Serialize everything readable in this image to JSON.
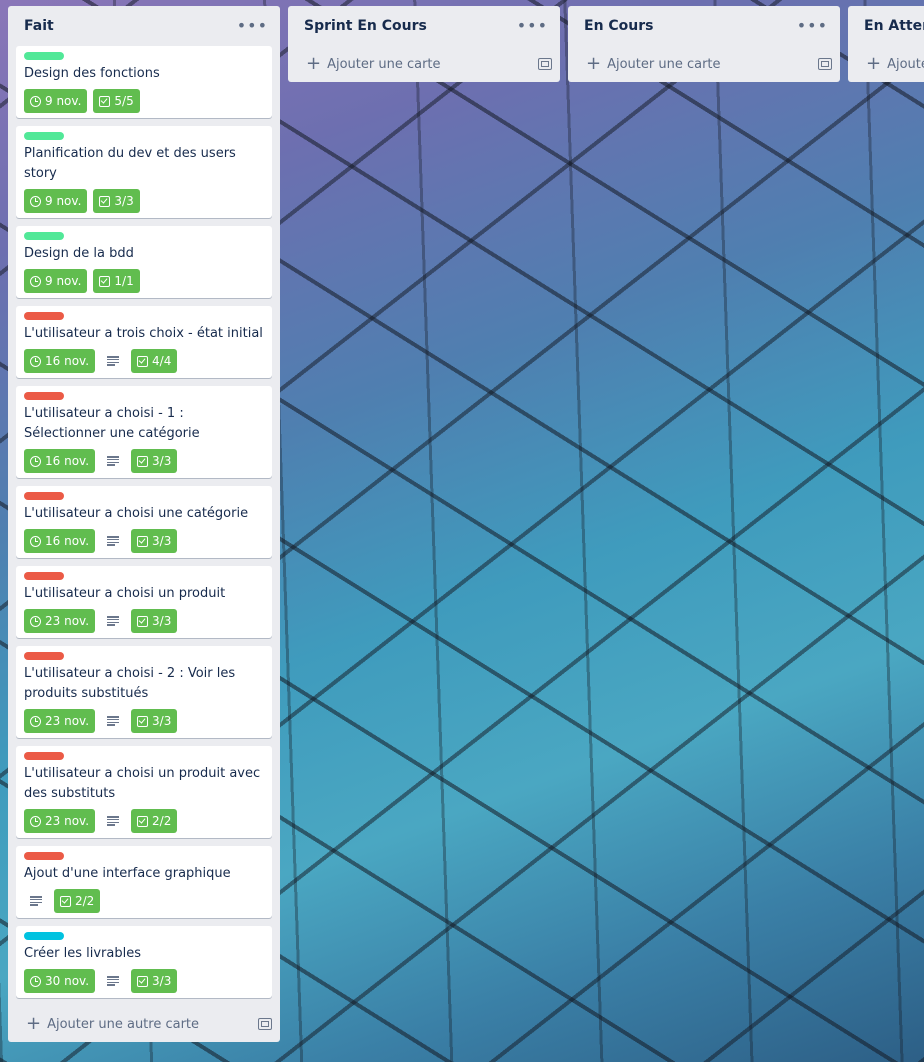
{
  "lists": [
    {
      "title": "Fait",
      "add_label": "Ajouter une autre carte",
      "cards": [
        {
          "label_color": "#51e898",
          "title": "Design des fonctions",
          "due": "9 nov.",
          "description": false,
          "checklist": "5/5"
        },
        {
          "label_color": "#51e898",
          "title": "Planification du dev et des users story",
          "due": "9 nov.",
          "description": false,
          "checklist": "3/3"
        },
        {
          "label_color": "#51e898",
          "title": "Design de la bdd",
          "due": "9 nov.",
          "description": false,
          "checklist": "1/1"
        },
        {
          "label_color": "#eb5a46",
          "title": "L'utilisateur a trois choix - état initial",
          "due": "16 nov.",
          "description": true,
          "checklist": "4/4"
        },
        {
          "label_color": "#eb5a46",
          "title": "L'utilisateur a choisi - 1 : Sélectionner une catégorie",
          "due": "16 nov.",
          "description": true,
          "checklist": "3/3"
        },
        {
          "label_color": "#eb5a46",
          "title": "L'utilisateur a choisi une catégorie",
          "due": "16 nov.",
          "description": true,
          "checklist": "3/3"
        },
        {
          "label_color": "#eb5a46",
          "title": "L'utilisateur a choisi un produit",
          "due": "23 nov.",
          "description": true,
          "checklist": "3/3"
        },
        {
          "label_color": "#eb5a46",
          "title": "L'utilisateur a choisi - 2 : Voir les produits substitués",
          "due": "23 nov.",
          "description": true,
          "checklist": "3/3"
        },
        {
          "label_color": "#eb5a46",
          "title": "L'utilisateur a choisi un produit avec des substituts",
          "due": "23 nov.",
          "description": true,
          "checklist": "2/2"
        },
        {
          "label_color": "#eb5a46",
          "title": "Ajout d'une interface graphique",
          "due": null,
          "description": true,
          "checklist": "2/2"
        },
        {
          "label_color": "#00c2e0",
          "title": "Créer les livrables",
          "due": "30 nov.",
          "description": true,
          "checklist": "3/3"
        }
      ]
    },
    {
      "title": "Sprint En Cours",
      "add_label": "Ajouter une carte",
      "cards": []
    },
    {
      "title": "En Cours",
      "add_label": "Ajouter une carte",
      "cards": []
    },
    {
      "title": "En Attente",
      "add_label": "Ajouter une carte",
      "cards": []
    }
  ]
}
